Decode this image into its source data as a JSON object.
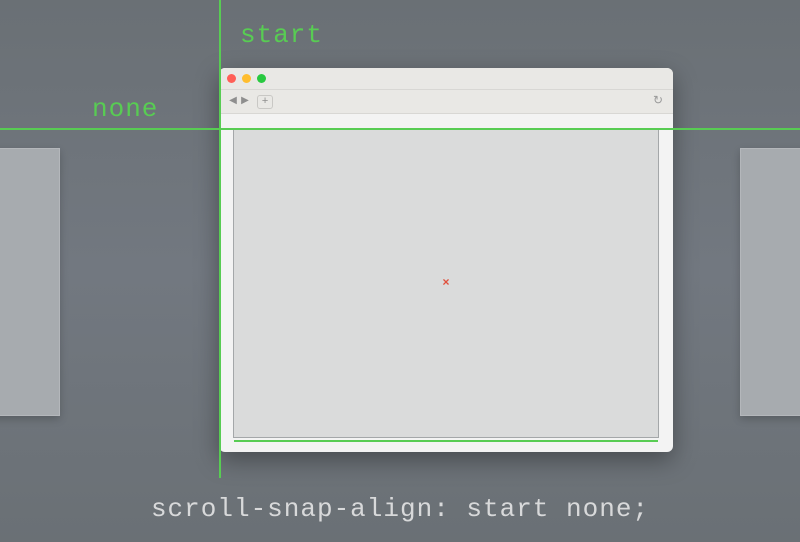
{
  "labels": {
    "start": "start",
    "none": "none"
  },
  "caption": "scroll-snap-align: start none;",
  "browser": {
    "traffic": {
      "close": "#ff5f57",
      "min": "#ffbd2e",
      "max": "#28c940"
    },
    "back_icon": "◀",
    "fwd_icon": "▶",
    "plus": "+",
    "reload": "↻"
  },
  "marker": "×"
}
